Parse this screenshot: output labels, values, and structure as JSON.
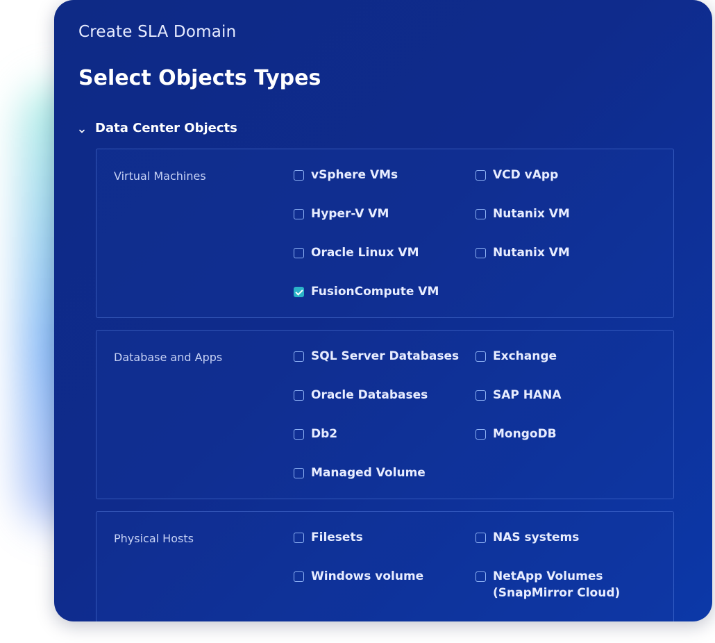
{
  "header": {
    "breadcrumb": "Create SLA Domain",
    "title": "Select Objects Types"
  },
  "section": {
    "title": "Data Center Objects",
    "expanded": true
  },
  "groups": [
    {
      "label": "Virtual Machines",
      "options": [
        {
          "label": "vSphere VMs",
          "checked": false
        },
        {
          "label": "VCD vApp",
          "checked": false
        },
        {
          "label": "Hyper-V VM",
          "checked": false
        },
        {
          "label": "Nutanix VM",
          "checked": false
        },
        {
          "label": "Oracle Linux VM",
          "checked": false
        },
        {
          "label": "Nutanix VM",
          "checked": false
        },
        {
          "label": "FusionCompute VM",
          "checked": true
        }
      ]
    },
    {
      "label": "Database and Apps",
      "options": [
        {
          "label": "SQL Server Databases",
          "checked": false
        },
        {
          "label": "Exchange",
          "checked": false
        },
        {
          "label": "Oracle Databases",
          "checked": false
        },
        {
          "label": "SAP HANA",
          "checked": false
        },
        {
          "label": "Db2",
          "checked": false
        },
        {
          "label": "MongoDB",
          "checked": false
        },
        {
          "label": "Managed Volume",
          "checked": false
        }
      ]
    },
    {
      "label": "Physical Hosts",
      "options": [
        {
          "label": "Filesets",
          "checked": false
        },
        {
          "label": "NAS systems",
          "checked": false
        },
        {
          "label": "Windows volume",
          "checked": false
        },
        {
          "label": "NetApp Volumes (SnapMirror Cloud)",
          "checked": false
        }
      ]
    }
  ],
  "colors": {
    "panel_bg": "#0e2a86",
    "checkbox_border": "#8fb3f5",
    "checkbox_checked": "#2bb3c7"
  }
}
